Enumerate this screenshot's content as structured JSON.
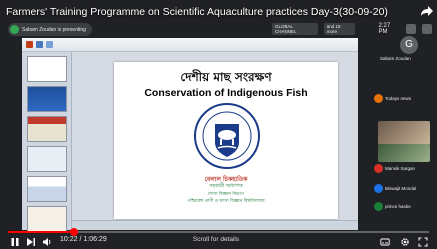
{
  "video": {
    "title": "Farmers' Training Programme on Scientific Aquaculture practices Day-3(30-09-20)",
    "presenter_banner": "Sabam Zoudan is presenting"
  },
  "meet_bar": {
    "chip1": "GLOBAL CHANNEL",
    "chip2": "and 16 more",
    "clock": "2:27 PM"
  },
  "slide": {
    "title_bn": "দেশীয় মাছ সংরক্ষণ",
    "title_en": "Conservation of Indigenous Fish",
    "author_bn": "বেলাল চিকহ্যতিক",
    "designation_bn": "সহকারী অধ্যাপক",
    "dept_line1_bn": "মৎস্য বিজ্ঞান বিভাগ",
    "dept_line2_bn": "পশ্চিমবঙ্গ প্রাণী ও মৎস্য বিজ্ঞান বিশ্ববিদ্যালয়"
  },
  "participants": [
    {
      "initial": "G",
      "name": "Sabam Zoudan"
    },
    {
      "name": "Todays news"
    },
    {
      "name": "Mansik Sargan"
    },
    {
      "name": "Biswajit Mondal"
    },
    {
      "name": "prince hasbe"
    }
  ],
  "player": {
    "time": "10:22 / 1:06:29",
    "scroll_hint": "Scroll for details",
    "progress_fraction": 0.157
  },
  "colors": {
    "progress": "#ff0000",
    "presenter_dot": "#34a853"
  }
}
